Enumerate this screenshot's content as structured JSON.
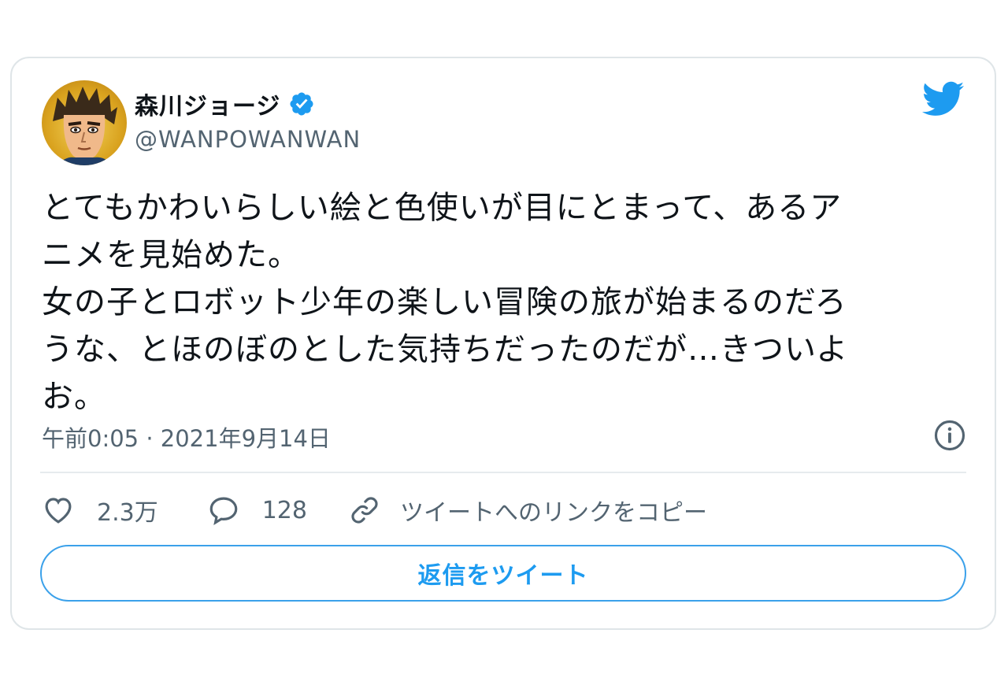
{
  "author": {
    "display_name": "森川ジョージ",
    "handle": "@WANPOWANWAN",
    "verified_icon": "verified-badge-icon",
    "avatar": "avatar-image"
  },
  "brand_icon": "twitter-bird-icon",
  "tweet": {
    "text": "とてもかわいらしい絵と色使いが目にとまって、あるア\nニメを見始めた。\n女の子とロボット少年の楽しい冒険の旅が始まるのだろ\nうな、とほのぼのとした気持ちだったのだが…きついよ\nお。",
    "timestamp": "午前0:05 · 2021年9月14日"
  },
  "actions": {
    "likes": {
      "icon": "heart-icon",
      "count": "2.3万"
    },
    "replies": {
      "icon": "speech-bubble-icon",
      "count": "128"
    },
    "copy_link": {
      "icon": "link-icon",
      "label": "ツイートへのリンクをコピー"
    }
  },
  "reply_button": {
    "label": "返信をツイート"
  },
  "colors": {
    "accent": "#1d9bf0",
    "verified": "#1d9bf0",
    "secondary_text": "#536471",
    "border": "#dfe5e8"
  }
}
